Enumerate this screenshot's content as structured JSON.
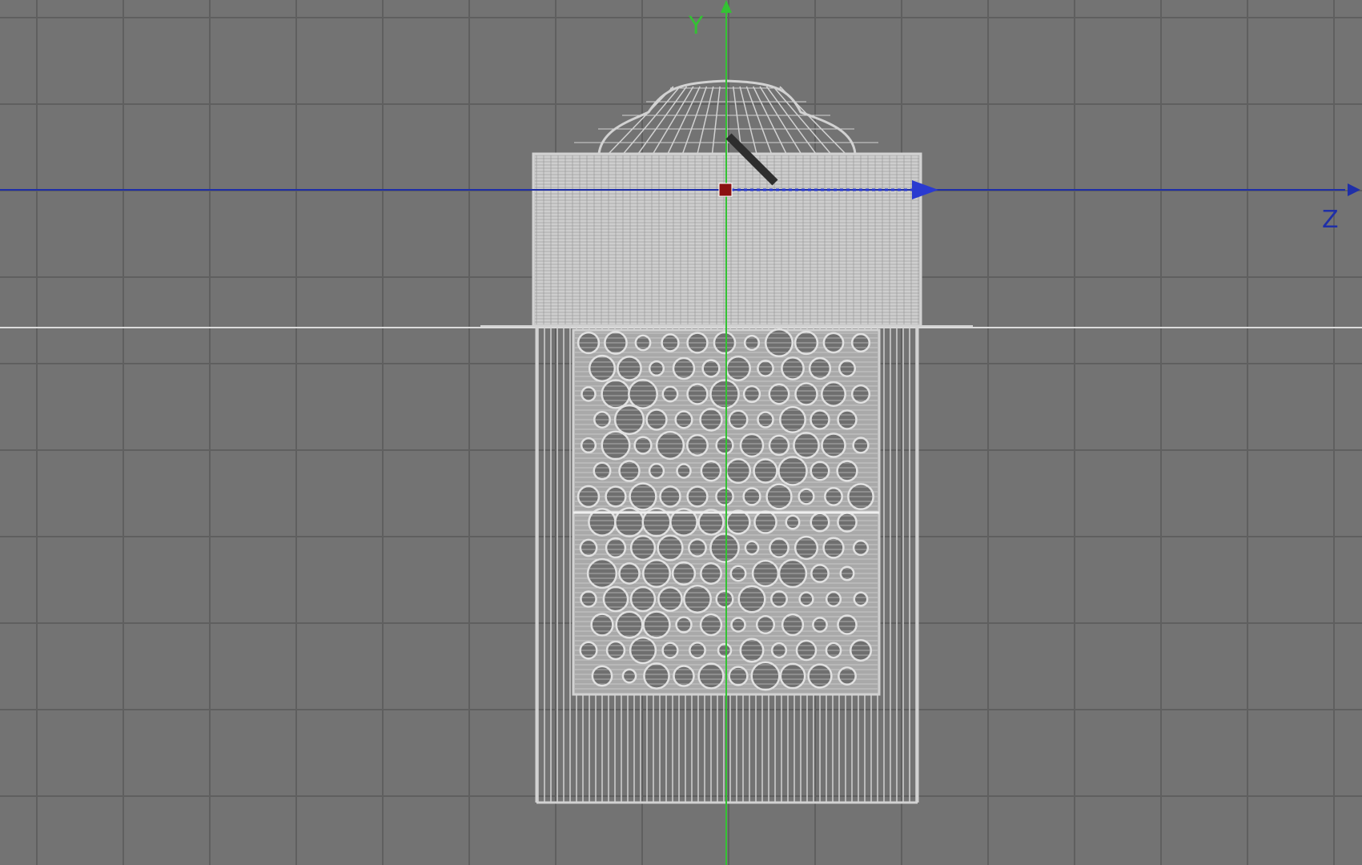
{
  "viewport": {
    "background": "#737373",
    "grid_color": "#5f5f5f",
    "wire_color": "#d2d2d2"
  },
  "axes": {
    "y": {
      "label": "Y",
      "color": "#33c233",
      "icon": "y-axis-arrow-icon"
    },
    "z": {
      "label": "Z",
      "color": "#1f2fa8",
      "icon": "z-axis-arrow-icon"
    }
  },
  "gizmo": {
    "pivot_color": "#8b1111",
    "icon": "move-pivot-icon"
  }
}
